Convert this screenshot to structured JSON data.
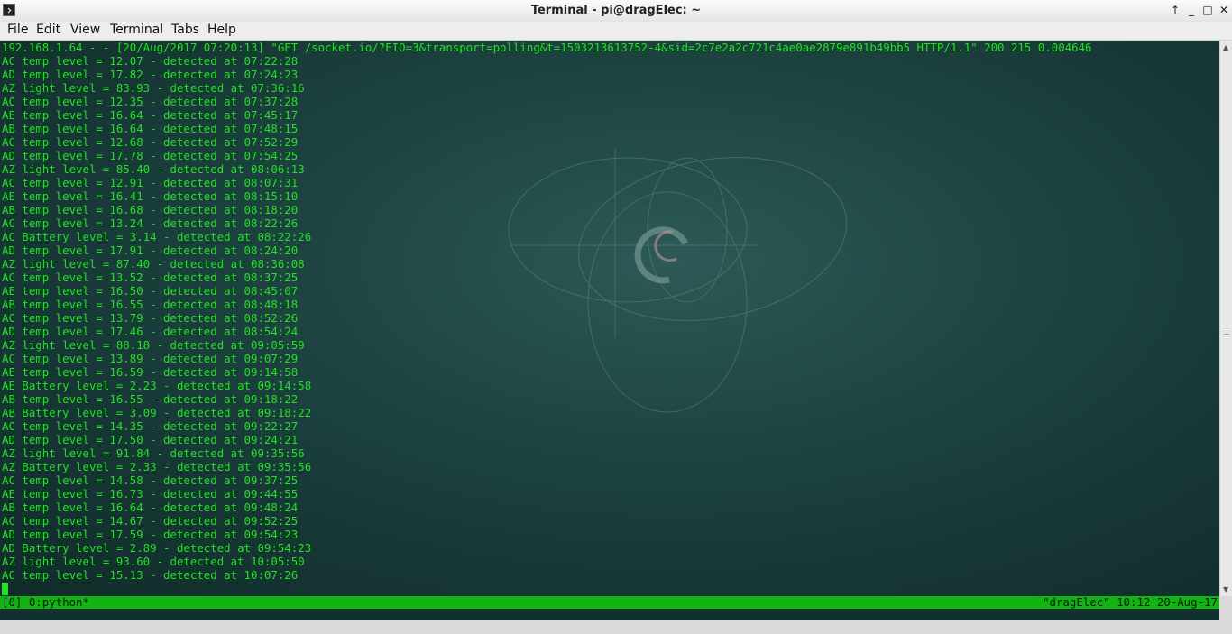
{
  "window": {
    "title": "Terminal - pi@dragElec: ~",
    "controls": [
      "↑",
      "_",
      "□",
      "✕"
    ]
  },
  "menu": [
    "File",
    "Edit",
    "View",
    "Terminal",
    "Tabs",
    "Help"
  ],
  "terminal": {
    "lines": [
      "192.168.1.64 - - [20/Aug/2017 07:20:13] \"GET /socket.io/?EIO=3&transport=polling&t=1503213613752-4&sid=2c7e2a2c721c4ae0ae2879e891b49bb5 HTTP/1.1\" 200 215 0.004646",
      "AC temp level = 12.07 - detected at 07:22:28",
      "AD temp level = 17.82 - detected at 07:24:23",
      "AZ light level = 83.93 - detected at 07:36:16",
      "AC temp level = 12.35 - detected at 07:37:28",
      "AE temp level = 16.64 - detected at 07:45:17",
      "AB temp level = 16.64 - detected at 07:48:15",
      "AC temp level = 12.68 - detected at 07:52:29",
      "AD temp level = 17.78 - detected at 07:54:25",
      "AZ light level = 85.40 - detected at 08:06:13",
      "AC temp level = 12.91 - detected at 08:07:31",
      "AE temp level = 16.41 - detected at 08:15:10",
      "AB temp level = 16.68 - detected at 08:18:20",
      "AC temp level = 13.24 - detected at 08:22:26",
      "AC Battery level = 3.14 - detected at 08:22:26",
      "AD temp level = 17.91 - detected at 08:24:20",
      "AZ light level = 87.40 - detected at 08:36:08",
      "AC temp level = 13.52 - detected at 08:37:25",
      "AE temp level = 16.50 - detected at 08:45:07",
      "AB temp level = 16.55 - detected at 08:48:18",
      "AC temp level = 13.79 - detected at 08:52:26",
      "AD temp level = 17.46 - detected at 08:54:24",
      "AZ light level = 88.18 - detected at 09:05:59",
      "AC temp level = 13.89 - detected at 09:07:29",
      "AE temp level = 16.59 - detected at 09:14:58",
      "AE Battery level = 2.23 - detected at 09:14:58",
      "AB temp level = 16.55 - detected at 09:18:22",
      "AB Battery level = 3.09 - detected at 09:18:22",
      "AC temp level = 14.35 - detected at 09:22:27",
      "AD temp level = 17.50 - detected at 09:24:21",
      "AZ light level = 91.84 - detected at 09:35:56",
      "AZ Battery level = 2.33 - detected at 09:35:56",
      "AC temp level = 14.58 - detected at 09:37:25",
      "AE temp level = 16.73 - detected at 09:44:55",
      "AB temp level = 16.64 - detected at 09:48:24",
      "AC temp level = 14.67 - detected at 09:52:25",
      "AD temp level = 17.59 - detected at 09:54:23",
      "AD Battery level = 2.89 - detected at 09:54:23",
      "AZ light level = 93.60 - detected at 10:05:50",
      "AC temp level = 15.13 - detected at 10:07:26"
    ]
  },
  "status_bar": {
    "left": "[0] 0:python*",
    "right": "\"dragElec\" 10:12 20-Aug-17"
  },
  "colors": {
    "terminal_text": "#22e022",
    "status_bar_bg": "#11b411",
    "terminal_bg": "#1f4643"
  },
  "icons": [
    "terminal-app-icon",
    "debian-swirl-wallpaper"
  ]
}
